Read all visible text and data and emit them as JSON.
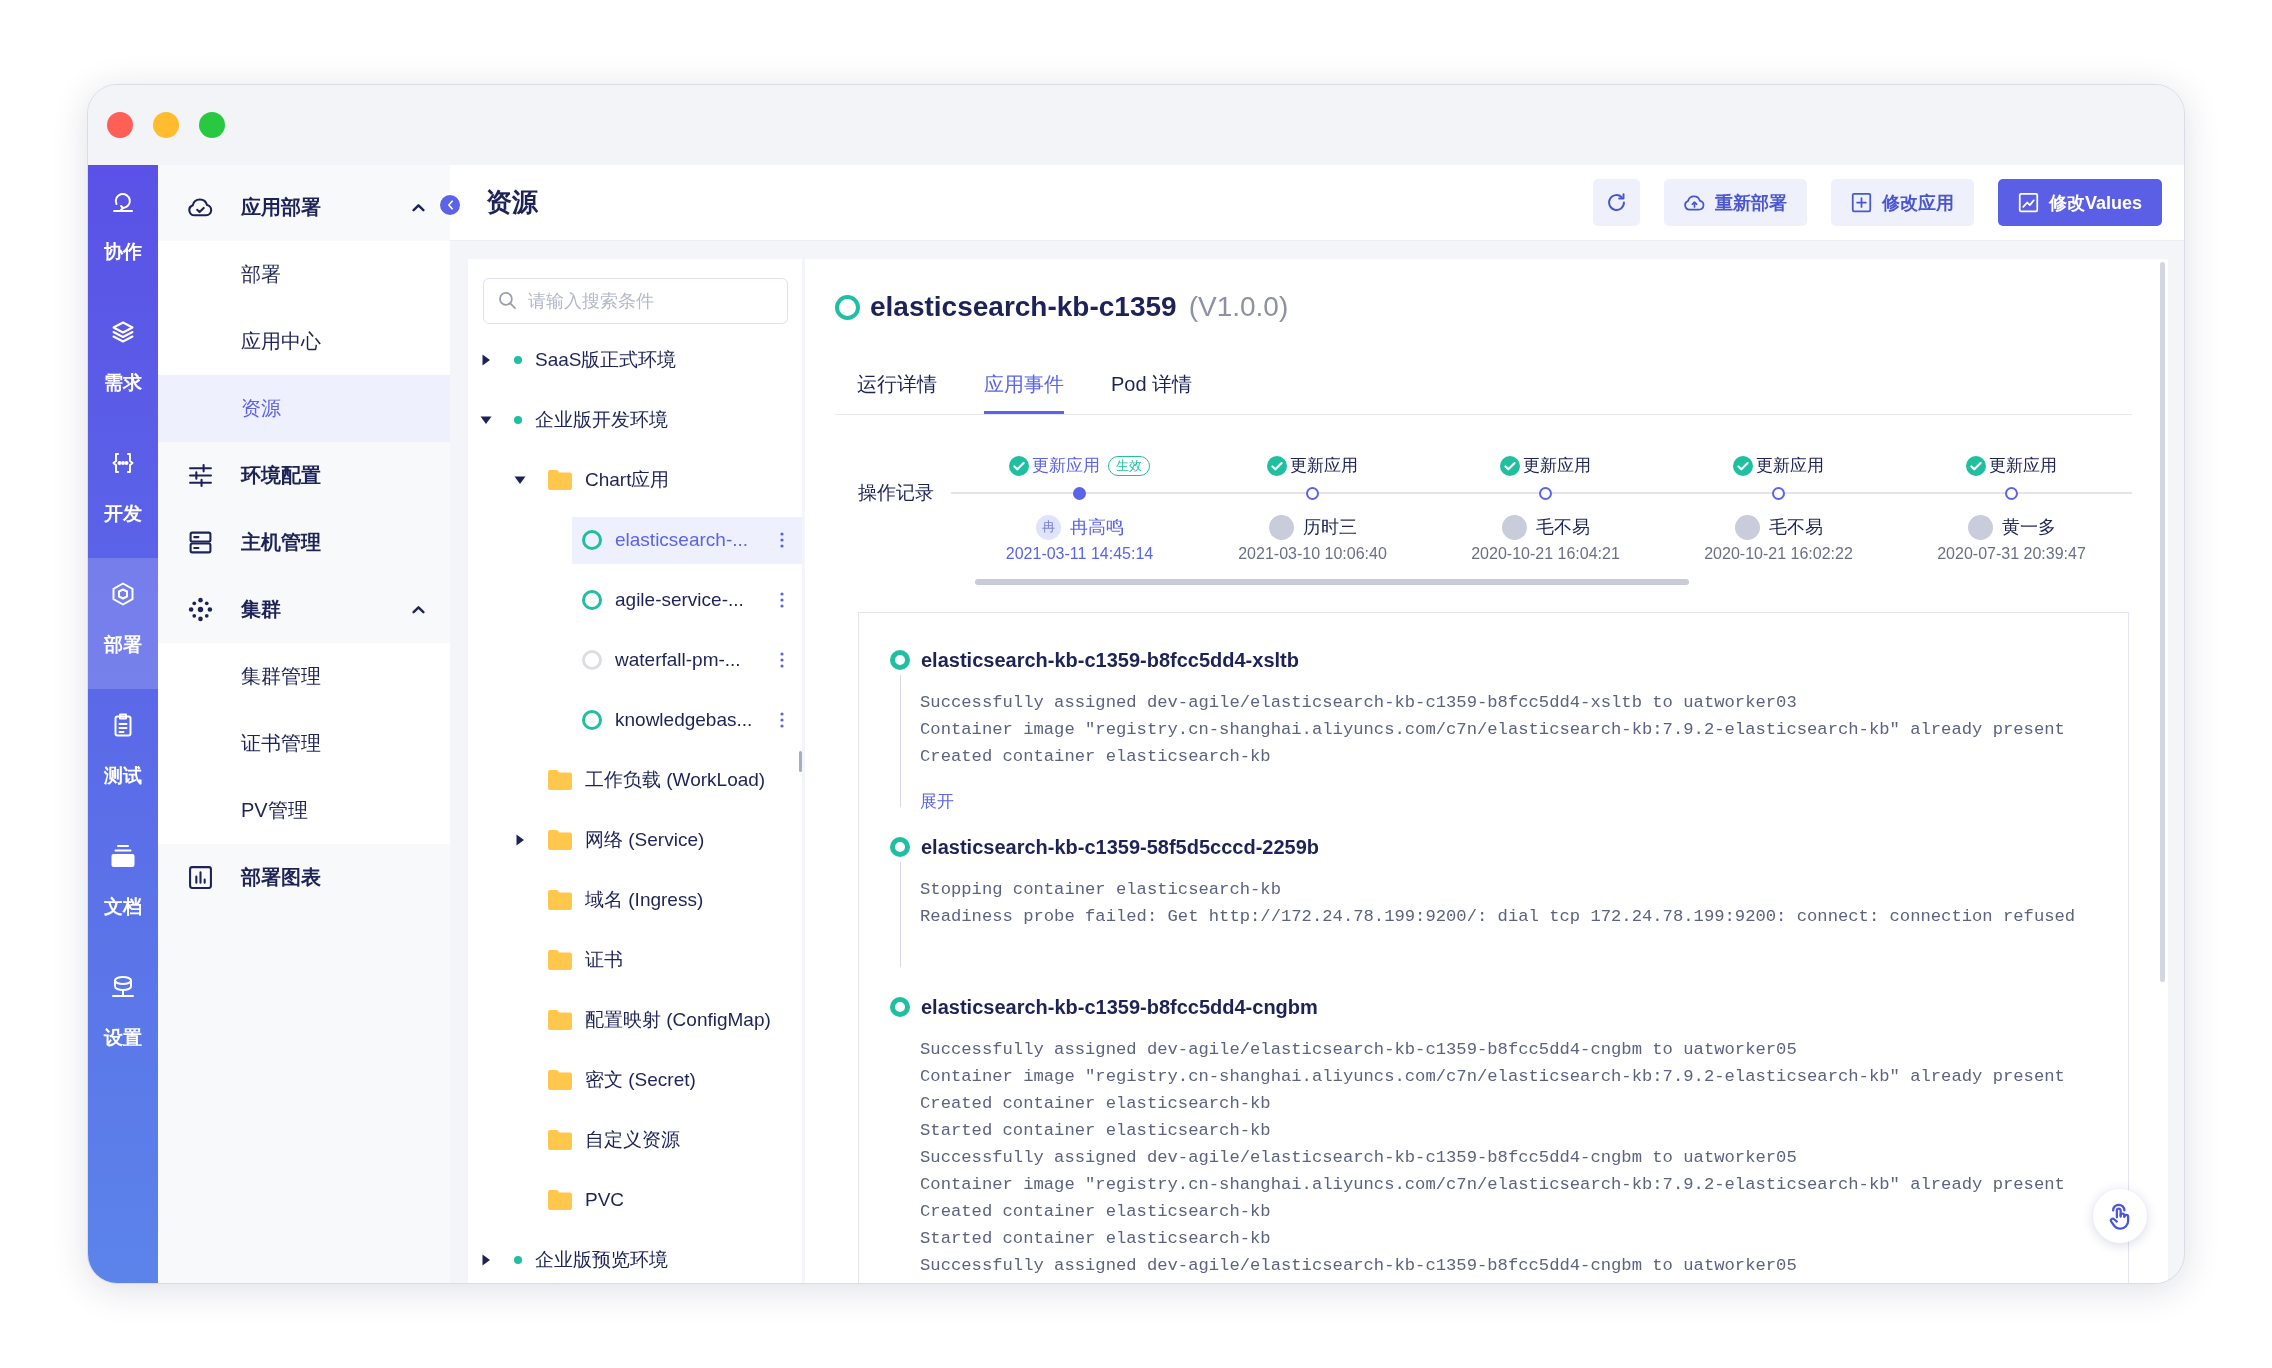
{
  "rail": {
    "items": [
      {
        "label": "协作",
        "selected": false
      },
      {
        "label": "需求",
        "selected": false
      },
      {
        "label": "开发",
        "selected": false
      },
      {
        "label": "部署",
        "selected": true
      },
      {
        "label": "测试",
        "selected": false
      },
      {
        "label": "文档",
        "selected": false
      },
      {
        "label": "设置",
        "selected": false
      }
    ]
  },
  "nav": {
    "items": [
      {
        "label": "应用部署",
        "selected": false,
        "expanded": true,
        "children": [
          {
            "label": "部署",
            "selected": false
          },
          {
            "label": "应用中心",
            "selected": false
          },
          {
            "label": "资源",
            "selected": true
          }
        ]
      },
      {
        "label": "环境配置",
        "selected": false
      },
      {
        "label": "主机管理",
        "selected": false
      },
      {
        "label": "集群",
        "selected": false,
        "expanded": true,
        "children": [
          {
            "label": "集群管理",
            "selected": false
          },
          {
            "label": "证书管理",
            "selected": false
          },
          {
            "label": "PV管理",
            "selected": false
          }
        ]
      },
      {
        "label": "部署图表",
        "selected": false
      }
    ]
  },
  "header": {
    "title": "资源",
    "buttons": [
      {
        "label": "重新部署",
        "primary": false
      },
      {
        "label": "修改应用",
        "primary": false
      },
      {
        "label": "修改Values",
        "primary": true
      }
    ]
  },
  "tree": {
    "search": {
      "placeholder": "请输入搜索条件"
    },
    "nodes": [
      {
        "label": "SaaS版正式环境",
        "kind": "env",
        "color": "#1fbf9f",
        "expanded": false,
        "selected": false
      },
      {
        "label": "企业版开发环境",
        "kind": "env",
        "color": "#1fbf9f",
        "expanded": true,
        "selected": false,
        "children": [
          {
            "label": "Chart应用",
            "kind": "folder",
            "expanded": true,
            "selected": false,
            "children": [
              {
                "label": "elasticsearch-...",
                "kind": "app",
                "color": "#1fbf9f",
                "selected": true
              },
              {
                "label": "agile-service-...",
                "kind": "app",
                "color": "#1fbf9f",
                "selected": false
              },
              {
                "label": "waterfall-pm-...",
                "kind": "app",
                "color": "#dcdde3",
                "selected": false
              },
              {
                "label": "knowledgebas...",
                "kind": "app",
                "color": "#1fbf9f",
                "selected": false
              }
            ]
          },
          {
            "label": "工作负载 (WorkLoad)",
            "kind": "folder",
            "selected": false
          },
          {
            "label": "网络 (Service)",
            "kind": "folder",
            "expanded": false,
            "selected": false
          },
          {
            "label": "域名 (Ingress)",
            "kind": "folder",
            "selected": false
          },
          {
            "label": "证书",
            "kind": "folder",
            "selected": false
          },
          {
            "label": "配置映射 (ConfigMap)",
            "kind": "folder",
            "selected": false
          },
          {
            "label": "密文 (Secret)",
            "kind": "folder",
            "selected": false
          },
          {
            "label": "自定义资源",
            "kind": "folder",
            "selected": false
          },
          {
            "label": "PVC",
            "kind": "folder",
            "selected": false
          }
        ]
      },
      {
        "label": "企业版预览环境",
        "kind": "env",
        "color": "#1fbf9f",
        "expanded": false,
        "selected": false
      }
    ]
  },
  "detail": {
    "color": "#1fbf9f",
    "name": "elasticsearch-kb-c1359",
    "version": "(V1.0.0)",
    "tabs": [
      {
        "label": "运行详情",
        "selected": false
      },
      {
        "label": "应用事件",
        "selected": true
      },
      {
        "label": "Pod 详情",
        "selected": false
      }
    ],
    "history": {
      "label": "操作记录",
      "items": [
        {
          "action": "更新应用",
          "tag": "生效",
          "selected": true,
          "avatar": {
            "kind": "initial",
            "text": "冉"
          },
          "user": "冉高鸣",
          "time": "2021-03-11 14:45:14"
        },
        {
          "action": "更新应用",
          "selected": false,
          "avatar": {
            "kind": "photo"
          },
          "user": "历时三",
          "time": "2021-03-10 10:06:40"
        },
        {
          "action": "更新应用",
          "selected": false,
          "avatar": {
            "kind": "photo"
          },
          "user": "毛不易",
          "time": "2020-10-21 16:04:21"
        },
        {
          "action": "更新应用",
          "selected": false,
          "avatar": {
            "kind": "photo"
          },
          "user": "毛不易",
          "time": "2020-10-21 16:02:22"
        },
        {
          "action": "更新应用",
          "selected": false,
          "avatar": {
            "kind": "photo"
          },
          "user": "黄一多",
          "time": "2020-07-31 20:39:47"
        }
      ]
    },
    "events": [
      {
        "name": "elasticsearch-kb-c1359-b8fcc5dd4-xsltb",
        "lines": [
          "Successfully assigned dev-agile/elasticsearch-kb-c1359-b8fcc5dd4-xsltb to uatworker03",
          "Container image \"registry.cn-shanghai.aliyuncs.com/c7n/elasticsearch-kb:7.9.2-elasticsearch-kb\" already present",
          "Created container elasticsearch-kb"
        ],
        "link": "展开"
      },
      {
        "name": "elasticsearch-kb-c1359-58f5d5cccd-2259b",
        "lines": [
          "Stopping container elasticsearch-kb",
          "Readiness probe failed: Get http://172.24.78.199:9200/: dial tcp 172.24.78.199:9200: connect: connection refused"
        ]
      },
      {
        "name": "elasticsearch-kb-c1359-b8fcc5dd4-cngbm",
        "lines": [
          "Successfully assigned dev-agile/elasticsearch-kb-c1359-b8fcc5dd4-cngbm to uatworker05",
          "Container image \"registry.cn-shanghai.aliyuncs.com/c7n/elasticsearch-kb:7.9.2-elasticsearch-kb\" already present",
          "Created container elasticsearch-kb",
          "Started container elasticsearch-kb",
          "Successfully assigned dev-agile/elasticsearch-kb-c1359-b8fcc5dd4-cngbm to uatworker05",
          "Container image \"registry.cn-shanghai.aliyuncs.com/c7n/elasticsearch-kb:7.9.2-elasticsearch-kb\" already present",
          "Created container elasticsearch-kb",
          "Started container elasticsearch-kb",
          "Successfully assigned dev-agile/elasticsearch-kb-c1359-b8fcc5dd4-cngbm to uatworker05"
        ]
      }
    ]
  }
}
